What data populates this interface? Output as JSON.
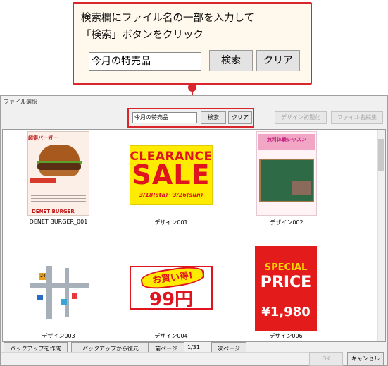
{
  "callout": {
    "line1": "検索欄にファイル名の一部を入力して",
    "line2": "「検索」ボタンをクリック",
    "search_value": "今月の特売品",
    "search_button": "検索",
    "clear_button": "クリア"
  },
  "dialog": {
    "title": "ファイル選択",
    "search_value": "今月の特売品",
    "search_button": "検索",
    "clear_button": "クリア",
    "design_reset_button": "デザイン初期化",
    "filename_edit_button": "ファイル名編集"
  },
  "items": [
    {
      "caption": "DENET BURGER_001",
      "head": "超得バーガー",
      "shop": "DENET BURGER"
    },
    {
      "caption": "デザイン001",
      "line1": "CLEARANCE",
      "line2": "SALE",
      "date": "3/18(sta)~3/26(sun)"
    },
    {
      "caption": "デザイン002",
      "title": "無料体験レッスン",
      "footer": "テテット○○○○教室"
    },
    {
      "caption": "デザイン003",
      "pin": "24"
    },
    {
      "caption": "デザイン004",
      "badge": "お買い得!",
      "price": "99円"
    },
    {
      "caption": "デザイン006",
      "line1": "SPECIAL",
      "line2": "PRICE",
      "line3": "¥1,980"
    }
  ],
  "bottom": {
    "backup_create": "バックアップを作成",
    "backup_restore": "バックアップから復元",
    "prev_page": "前ページ",
    "page_indicator": "1/31",
    "next_page": "次ページ",
    "ok": "OK",
    "cancel": "キャンセル"
  }
}
